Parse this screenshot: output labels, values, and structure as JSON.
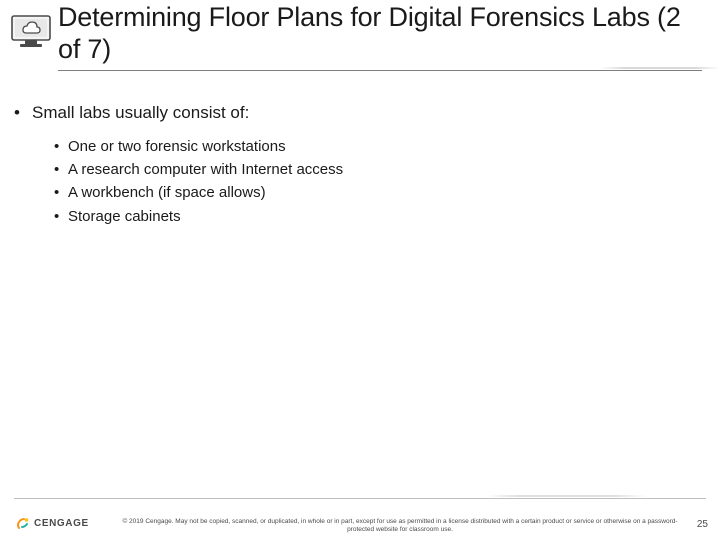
{
  "slide": {
    "title": "Determining Floor Plans for Digital Forensics Labs (2 of 7)",
    "icon": "cloud-monitor-icon"
  },
  "content": {
    "lead": "Small labs usually consist of:",
    "items": [
      "One or two forensic workstations",
      "A research computer with Internet access",
      "A workbench (if space allows)",
      "Storage cabinets"
    ]
  },
  "footer": {
    "brand": "CENGAGE",
    "copyright": "© 2019 Cengage. May not be copied, scanned, or duplicated, in whole or in part, except for use as permitted in a license distributed with a certain product or service or otherwise on a password-protected website for classroom use.",
    "page_number": "25"
  },
  "colors": {
    "accent_orange": "#f7941e",
    "accent_teal": "#1fb3a6",
    "accent_yellow": "#f5c518"
  }
}
